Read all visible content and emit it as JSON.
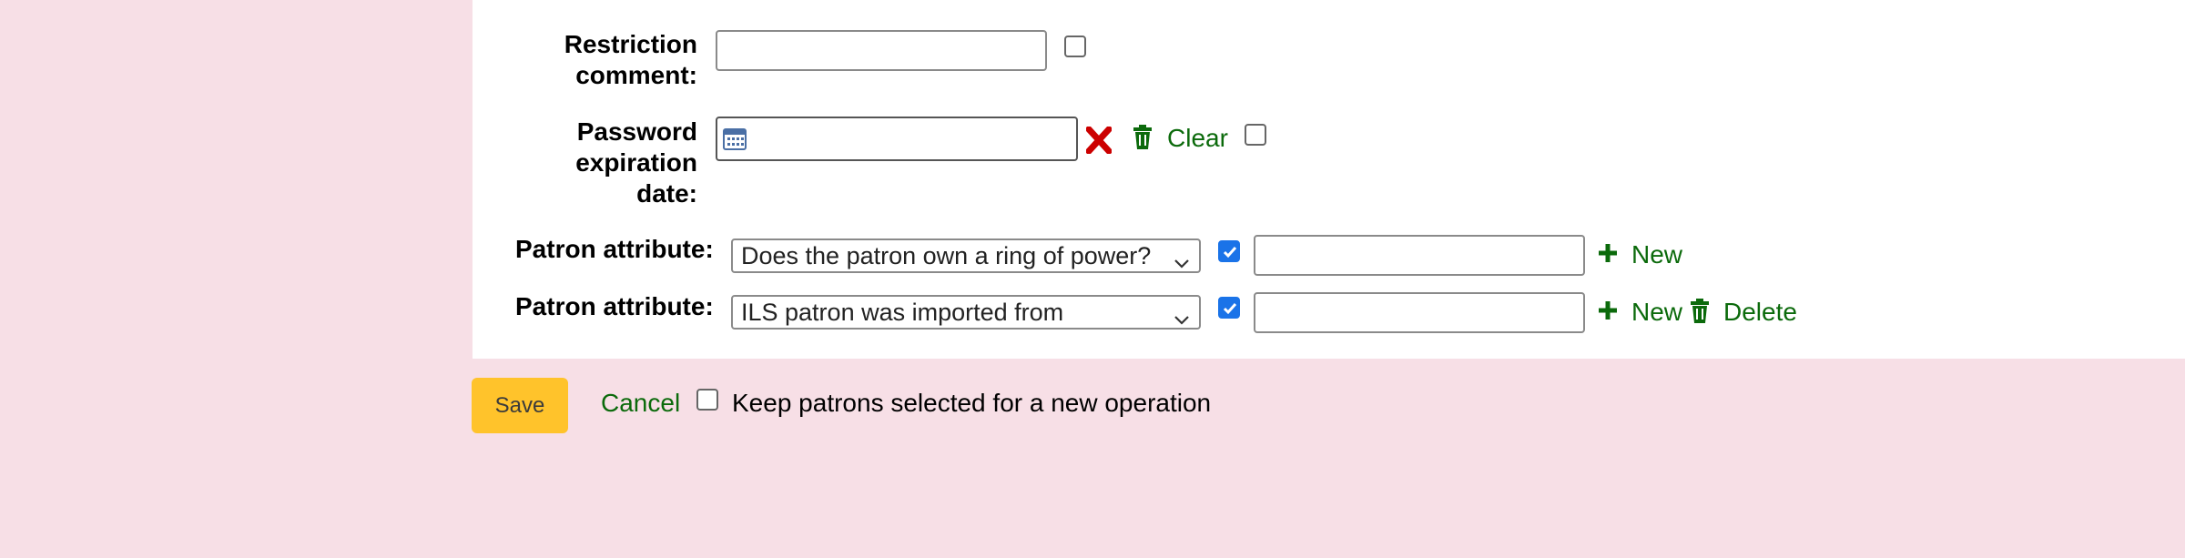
{
  "form": {
    "restriction_comment": {
      "label_line1": "Restriction",
      "label_line2": "comment:",
      "value": ""
    },
    "password_expiration": {
      "label_line1": "Password",
      "label_line2": "expiration",
      "label_line3": "date:",
      "value": "",
      "clear_label": "Clear"
    },
    "patron_attributes": [
      {
        "label": "Patron attribute:",
        "selected": "Does the patron own a ring of power?",
        "checked": true,
        "value": "",
        "new_label": "New"
      },
      {
        "label": "Patron attribute:",
        "selected": "ILS patron was imported from",
        "checked": true,
        "value": "",
        "new_label": "New",
        "delete_label": "Delete"
      }
    ]
  },
  "footer": {
    "save_label": "Save",
    "cancel_label": "Cancel",
    "keep_label": "Keep patrons selected for a new operation"
  },
  "colors": {
    "accent_green": "#0b6a0b",
    "save_yellow": "#ffc32b",
    "background_pink": "#f7dfe6",
    "delete_red": "#cc0000"
  },
  "icons": {
    "calendar": "calendar-icon",
    "clear_x": "x-icon",
    "trash": "trash-icon",
    "plus": "plus-icon",
    "checkbox": "checkbox"
  }
}
